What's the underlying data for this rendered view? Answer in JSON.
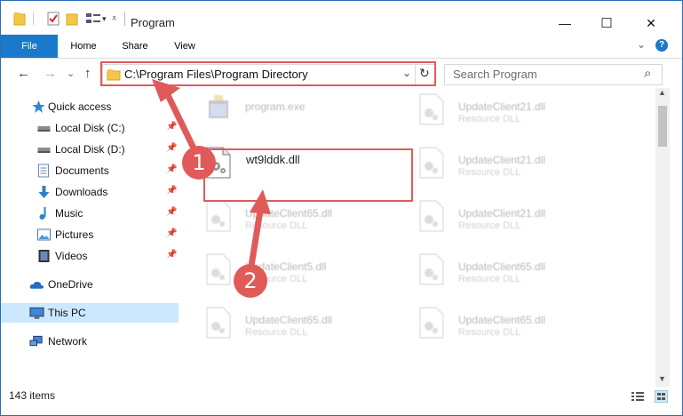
{
  "window": {
    "title": "Program",
    "minimize_glyph": "—",
    "maximize_glyph": "☐",
    "close_glyph": "✕",
    "expand_ribbon_glyph": "⌄",
    "help_glyph": "?"
  },
  "ribbon": {
    "file": "File",
    "home": "Home",
    "share": "Share",
    "view": "View"
  },
  "nav": {
    "back_glyph": "←",
    "forward_glyph": "→",
    "recent_glyph": "⌄",
    "up_glyph": "↑",
    "address": "C:\\Program Files\\Program Directory",
    "address_dropdown_glyph": "⌄",
    "refresh_glyph": "↻",
    "search_placeholder": "Search Program",
    "search_icon_glyph": "⌕"
  },
  "sidebar": {
    "items": [
      {
        "label": "Quick access",
        "icon": "star-icon",
        "pinned": false
      },
      {
        "label": "Local Disk (C:)",
        "icon": "drive-icon",
        "pinned": true
      },
      {
        "label": "Local Disk (D:)",
        "icon": "drive-icon",
        "pinned": true
      },
      {
        "label": "Documents",
        "icon": "documents-icon",
        "pinned": true
      },
      {
        "label": "Downloads",
        "icon": "download-icon",
        "pinned": true
      },
      {
        "label": "Music",
        "icon": "music-icon",
        "pinned": true
      },
      {
        "label": "Pictures",
        "icon": "pictures-icon",
        "pinned": true
      },
      {
        "label": "Videos",
        "icon": "videos-icon",
        "pinned": true
      },
      {
        "label": "OneDrive",
        "icon": "cloud-icon",
        "pinned": false
      },
      {
        "label": "This PC",
        "icon": "computer-icon",
        "pinned": false,
        "selected": true
      },
      {
        "label": "Network",
        "icon": "network-icon",
        "pinned": false
      }
    ],
    "pin_glyph": "📌"
  },
  "files": [
    {
      "name": "program.exe",
      "type": "",
      "faded": true,
      "icon": "exe-icon"
    },
    {
      "name": "UpdateClient21.dll",
      "type": "Resource DLL",
      "faded": true,
      "icon": "dll-icon"
    },
    {
      "name": "wt9lddk.dll",
      "type": "",
      "faded": false,
      "icon": "dll-icon"
    },
    {
      "name": "UpdateClient21.dll",
      "type": "Resource DLL",
      "faded": true,
      "icon": "dll-icon"
    },
    {
      "name": "UpdateClient65.dll",
      "type": "Resource DLL",
      "faded": true,
      "icon": "dll-icon"
    },
    {
      "name": "UpdateClient21.dll",
      "type": "Resource DLL",
      "faded": true,
      "icon": "dll-icon"
    },
    {
      "name": "UpdateClient5.dll",
      "type": "Resource DLL",
      "faded": true,
      "icon": "dll-icon"
    },
    {
      "name": "UpdateClient65.dll",
      "type": "Resource DLL",
      "faded": true,
      "icon": "dll-icon"
    },
    {
      "name": "UpdateClient65.dll",
      "type": "Resource DLL",
      "faded": true,
      "icon": "dll-icon"
    },
    {
      "name": "UpdateClient65.dll",
      "type": "Resource DLL",
      "faded": true,
      "icon": "dll-icon"
    }
  ],
  "status": {
    "items_count": "143 items"
  },
  "annotations": {
    "step1": "1",
    "step2": "2",
    "color": "#e05a5a"
  }
}
